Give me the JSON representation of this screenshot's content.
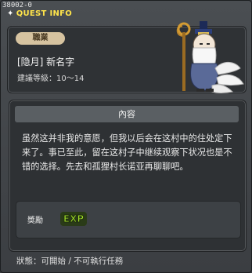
{
  "window": {
    "quest_id": "38002-0",
    "title": "QUEST INFO"
  },
  "npc_card": {
    "job_badge": "職業",
    "name": "[隐月] 新名字",
    "level_text": "建議等級：10～14"
  },
  "content": {
    "header": "內容",
    "text": "虽然这并非我的意愿，但我以后会在这村中的住处定下来了。事已至此，留在这村子中继续观察下状况也是不错的选择。先去和孤狸村长诺亚再聊聊吧。"
  },
  "reward": {
    "label": "獎勵",
    "exp_text": "EXP"
  },
  "status": {
    "text": "狀態：可開始 / 不可執行任務"
  },
  "colors": {
    "title": "#ffe44a",
    "exp_fill": "#a4e22a"
  }
}
